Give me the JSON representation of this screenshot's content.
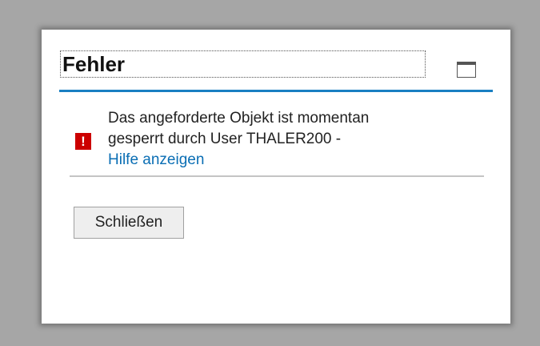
{
  "dialog": {
    "title": "Fehler",
    "message_line1": "Das angeforderte Objekt ist momentan",
    "message_line2": "gesperrt durch User THALER200 -",
    "help_link": "Hilfe anzeigen",
    "error_icon_glyph": "!",
    "close_label": "Schließen"
  },
  "icons": {
    "error": "error-icon",
    "maximize": "maximize-icon"
  },
  "colors": {
    "accent_line": "#1a7fc2",
    "error_icon": "#cc0000",
    "link": "#0a6eb4",
    "backdrop": "#a6a6a6"
  }
}
